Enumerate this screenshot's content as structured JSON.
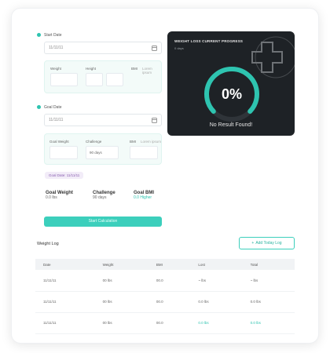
{
  "start": {
    "label": "Start Date",
    "date_value": "11/11/11",
    "weight_label": "Weight",
    "height_label": "Height",
    "bmi_label": "BMI",
    "bmi_hint": "Lorem ipsum"
  },
  "goal": {
    "label": "Goal Date",
    "date_value": "11/11/11",
    "goal_weight_label": "Goal Weight",
    "challenge_label": "Challenge",
    "challenge_value": "90 days",
    "bmi_label": "BMI",
    "bmi_hint": "Lorem ipsum",
    "goal_date_note": "Goal Date: 11/11/11"
  },
  "summary": {
    "goal_weight_label": "Goal Weight",
    "goal_weight_value": "0.0 lbs",
    "challenge_label": "Challenge",
    "challenge_value": "90 days",
    "goal_bmi_label": "Goal BMI",
    "goal_bmi_value": "0.0 Higher"
  },
  "start_button": "Start Calculation",
  "progress_card": {
    "title": "WEIGHT LOSS CURRENT PROGRESS",
    "subtitle": "0 days",
    "percent_text": "0%",
    "percent_value": 0,
    "message": "No Result Found!",
    "accent": "#2ec4b0"
  },
  "log": {
    "title": "Weight Log",
    "add_button": "Add Today Log",
    "columns": [
      "Date",
      "Weight",
      "BMI",
      "Lost",
      "Total"
    ],
    "rows": [
      {
        "date": "11/11/11",
        "weight": "00 lbs",
        "bmi": "00.0",
        "lost": "~ lbs",
        "total": "~ lbs",
        "lost_pos": false,
        "total_pos": false
      },
      {
        "date": "11/11/11",
        "weight": "00 lbs",
        "bmi": "00.0",
        "lost": "0.0 lbs",
        "total": "0.0 lbs",
        "lost_pos": false,
        "total_pos": false
      },
      {
        "date": "11/11/11",
        "weight": "00 lbs",
        "bmi": "00.0",
        "lost": "0.0 lbs",
        "total": "0.0 lbs",
        "lost_pos": true,
        "total_pos": true
      }
    ]
  },
  "icons": {
    "calendar": "calendar-icon",
    "plus": "plus-icon",
    "logo": "cross-logo-icon"
  }
}
